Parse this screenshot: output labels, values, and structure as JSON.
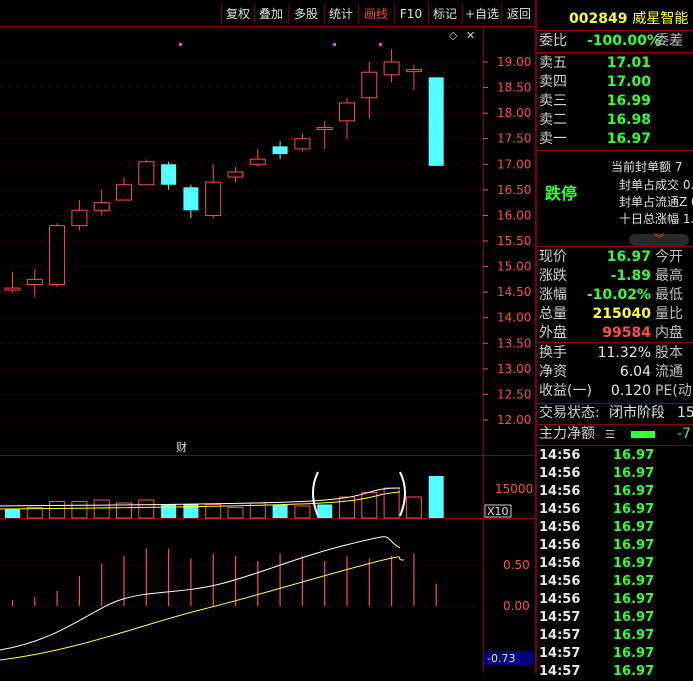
{
  "toolbar": {
    "items": [
      "复权",
      "叠加",
      "多股",
      "统计",
      "画线",
      "F10",
      "标记",
      "+自选",
      "返回"
    ],
    "active_index": 4
  },
  "stock": {
    "code": "002849",
    "name": "威星智能",
    "name_color": "#ffff33"
  },
  "order_book": {
    "weibi_label": "委比",
    "weibi_value": "-100.00%",
    "weicha_label": "委差",
    "levels": [
      {
        "label": "卖五",
        "price": "17.01"
      },
      {
        "label": "卖四",
        "price": "17.00"
      },
      {
        "label": "卖三",
        "price": "16.99"
      },
      {
        "label": "卖二",
        "price": "16.98"
      },
      {
        "label": "卖一",
        "price": "16.97"
      }
    ]
  },
  "limit": {
    "status": "跌停",
    "lines": [
      "当前封单额 7",
      "封单占成交 0.",
      "封单占流通Z 0",
      "十日总涨幅 1."
    ]
  },
  "quote": {
    "rows": [
      {
        "label": "现价",
        "value": "16.97",
        "color": "green",
        "right": "今开"
      },
      {
        "label": "涨跌",
        "value": "-1.89",
        "color": "green",
        "right": "最高"
      },
      {
        "label": "涨幅",
        "value": "-10.02%",
        "color": "green",
        "right": "最低"
      },
      {
        "label": "总量",
        "value": "215040",
        "color": "yellow",
        "right": "量比"
      },
      {
        "label": "外盘",
        "value": "99584",
        "color": "red",
        "right": "内盘"
      }
    ],
    "rows2": [
      {
        "label": "换手",
        "value": "11.32%",
        "color": "white",
        "right": "股本"
      },
      {
        "label": "净资",
        "value": "6.04",
        "color": "white",
        "right": "流通"
      },
      {
        "label": "收益(一)",
        "value": "0.120",
        "color": "white",
        "right": "PE(动"
      }
    ],
    "trade_status_label": "交易状态:",
    "trade_status_value": "闭市阶段",
    "trade_status_num": "15",
    "main_flow_label": "主力净额",
    "main_flow_value": "-7"
  },
  "ticks": [
    {
      "time": "14:56",
      "price": "16.97"
    },
    {
      "time": "14:56",
      "price": "16.97"
    },
    {
      "time": "14:56",
      "price": "16.97"
    },
    {
      "time": "14:56",
      "price": "16.97"
    },
    {
      "time": "14:56",
      "price": "16.97"
    },
    {
      "time": "14:56",
      "price": "16.97"
    },
    {
      "time": "14:56",
      "price": "16.97"
    },
    {
      "time": "14:56",
      "price": "16.97"
    },
    {
      "time": "14:56",
      "price": "16.97"
    },
    {
      "time": "14:57",
      "price": "16.97"
    },
    {
      "time": "14:57",
      "price": "16.97"
    },
    {
      "time": "14:57",
      "price": "16.97"
    },
    {
      "time": "14:57",
      "price": "16.97"
    }
  ],
  "chart_data": [
    {
      "type": "candlestick",
      "ylim": [
        11.9,
        19.2
      ],
      "y_ticks": [
        "19.00",
        "18.50",
        "18.00",
        "17.50",
        "17.00",
        "16.50",
        "16.00",
        "15.50",
        "15.00",
        "14.50",
        "14.00",
        "13.50",
        "13.00",
        "12.50",
        "12.00"
      ],
      "candles": [
        {
          "o": 14.55,
          "c": 14.58,
          "h": 14.9,
          "l": 14.5
        },
        {
          "o": 14.65,
          "c": 14.75,
          "h": 14.95,
          "l": 14.4
        },
        {
          "o": 14.65,
          "c": 15.8,
          "h": 15.85,
          "l": 14.6
        },
        {
          "o": 15.8,
          "c": 16.1,
          "h": 16.3,
          "l": 15.7
        },
        {
          "o": 16.1,
          "c": 16.25,
          "h": 16.5,
          "l": 16.0
        },
        {
          "o": 16.3,
          "c": 16.6,
          "h": 16.75,
          "l": 16.3
        },
        {
          "o": 16.6,
          "c": 17.05,
          "h": 17.1,
          "l": 16.6
        },
        {
          "o": 17.0,
          "c": 16.6,
          "h": 17.05,
          "l": 16.5
        },
        {
          "o": 16.55,
          "c": 16.1,
          "h": 16.6,
          "l": 15.95
        },
        {
          "o": 16.0,
          "c": 16.65,
          "h": 17.0,
          "l": 15.95
        },
        {
          "o": 16.75,
          "c": 16.85,
          "h": 16.95,
          "l": 16.65
        },
        {
          "o": 17.0,
          "c": 17.1,
          "h": 17.3,
          "l": 16.95
        },
        {
          "o": 17.35,
          "c": 17.2,
          "h": 17.45,
          "l": 17.1
        },
        {
          "o": 17.3,
          "c": 17.5,
          "h": 17.6,
          "l": 17.25
        },
        {
          "o": 17.7,
          "c": 17.72,
          "h": 17.85,
          "l": 17.3
        },
        {
          "o": 17.85,
          "c": 18.2,
          "h": 18.3,
          "l": 17.5
        },
        {
          "o": 18.3,
          "c": 18.8,
          "h": 19.0,
          "l": 17.9
        },
        {
          "o": 18.75,
          "c": 19.0,
          "h": 19.25,
          "l": 18.6
        },
        {
          "o": 18.85,
          "c": 18.85,
          "h": 18.95,
          "l": 18.45
        },
        {
          "o": 18.7,
          "c": 16.97,
          "h": 18.7,
          "l": 16.97
        }
      ],
      "volume": {
        "tick": "15000",
        "unit": "X10",
        "bars": [
          {
            "v": 0.3,
            "up": false
          },
          {
            "v": 0.35,
            "up": true
          },
          {
            "v": 0.55,
            "up": true
          },
          {
            "v": 0.55,
            "up": true
          },
          {
            "v": 0.6,
            "up": true
          },
          {
            "v": 0.5,
            "up": true
          },
          {
            "v": 0.6,
            "up": true
          },
          {
            "v": 0.45,
            "up": false
          },
          {
            "v": 0.45,
            "up": false
          },
          {
            "v": 0.45,
            "up": true
          },
          {
            "v": 0.35,
            "up": true
          },
          {
            "v": 0.5,
            "up": true
          },
          {
            "v": 0.45,
            "up": false
          },
          {
            "v": 0.4,
            "up": true
          },
          {
            "v": 0.45,
            "up": false
          },
          {
            "v": 0.7,
            "up": true
          },
          {
            "v": 0.85,
            "up": true
          },
          {
            "v": 1.0,
            "up": true
          },
          {
            "v": 0.7,
            "up": true
          },
          {
            "v": 1.4,
            "up": false
          }
        ],
        "finance_label": "财"
      },
      "indicator": {
        "ticks": [
          "0.50",
          "0.00"
        ],
        "current": "-0.73",
        "bars": [
          0.12,
          0.18,
          0.3,
          0.6,
          0.85,
          1.0,
          1.15,
          1.15,
          0.95,
          1.05,
          1.0,
          0.9,
          1.05,
          1.0,
          0.9,
          1.0,
          0.95,
          1.0,
          1.05,
          0.45
        ]
      }
    }
  ]
}
